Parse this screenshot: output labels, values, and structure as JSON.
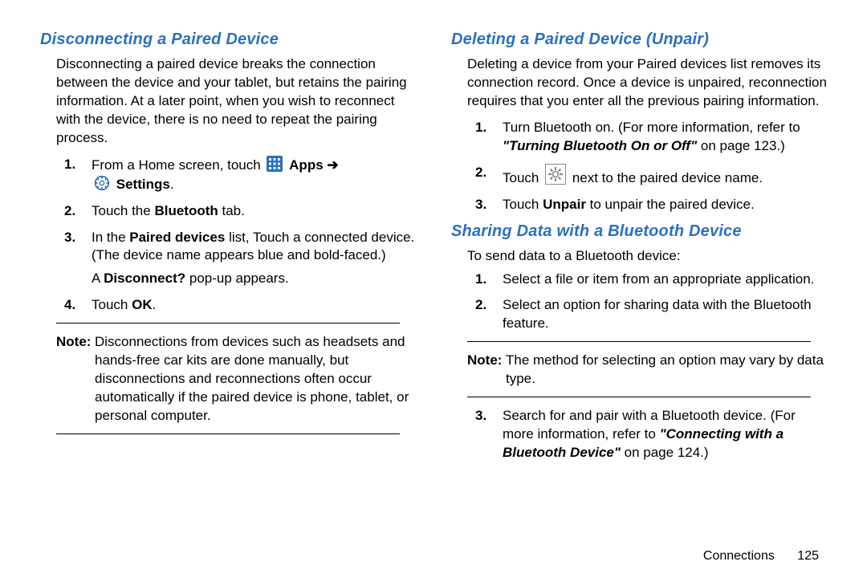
{
  "left": {
    "heading": "Disconnecting a Paired Device",
    "intro": "Disconnecting a paired device breaks the connection between the device and your tablet, but retains the pairing information. At a later point, when you wish to reconnect with the device, there is no need to repeat the pairing process.",
    "step1": {
      "num": "1.",
      "pre": "From a Home screen, touch ",
      "apps": "Apps",
      "arrow": " ➔ ",
      "settings": "Settings",
      "post": "."
    },
    "step2": {
      "num": "2.",
      "pre": "Touch the ",
      "bold": "Bluetooth",
      "post": " tab."
    },
    "step3": {
      "num": "3.",
      "pre": "In the ",
      "bold": "Paired devices",
      "mid": " list, Touch a connected device. (The device name appears blue and bold-faced.)",
      "line2a": "A ",
      "line2b": "Disconnect?",
      "line2c": " pop-up appears."
    },
    "step4": {
      "num": "4.",
      "pre": "Touch ",
      "bold": "OK",
      "post": "."
    },
    "note": {
      "label": "Note:",
      "text": "Disconnections from devices such as headsets and hands-free car kits are done manually, but disconnections and reconnections often occur automatically if the paired device is phone, tablet, or personal computer."
    }
  },
  "right": {
    "heading1": "Deleting a Paired Device (Unpair)",
    "intro1": "Deleting a device from your Paired devices list removes its connection record. Once a device is unpaired, reconnection requires that you enter all the previous pairing information.",
    "d_step1": {
      "num": "1.",
      "pre": "Turn Bluetooth on. (For more information, refer to ",
      "ref": "\"Turning Bluetooth On or Off\"",
      "post": " on page 123.)"
    },
    "d_step2": {
      "num": "2.",
      "pre": "Touch ",
      "post": " next to the paired device name."
    },
    "d_step3": {
      "num": "3.",
      "pre": "Touch ",
      "bold": "Unpair",
      "post": " to unpair the paired device."
    },
    "heading2": "Sharing Data with a Bluetooth Device",
    "intro2": "To send data to a Bluetooth device:",
    "s_step1": {
      "num": "1.",
      "text": "Select a file or item from an appropriate application."
    },
    "s_step2": {
      "num": "2.",
      "text": "Select an option for sharing data with the Bluetooth feature."
    },
    "note": {
      "label": "Note:",
      "text": "The method for selecting an option may vary by data type."
    },
    "s_step3": {
      "num": "3.",
      "pre": "Search for and pair with a Bluetooth device. (For more information, refer to ",
      "ref": "\"Connecting with a Bluetooth Device\"",
      "post": " on page 124.)"
    }
  },
  "footer": {
    "chapter": "Connections",
    "page": "125"
  }
}
